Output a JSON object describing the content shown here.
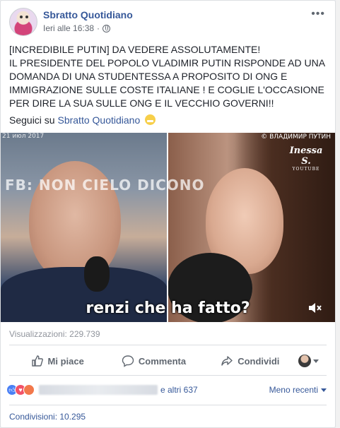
{
  "post": {
    "page_name": "Sbratto Quotidiano",
    "timestamp": "Ieri alle 16:38",
    "privacy_icon": "globe-icon",
    "more_icon": "ellipsis-icon",
    "text": "[INCREDIBILE PUTIN] DA VEDERE ASSOLUTAMENTE!\nIL PRESIDENTE DEL POPOLO VLADIMIR PUTIN RISPONDE AD UNA DOMANDA DI UNA STUDENTESSA A PROPOSITO DI ONG E IMMIGRAZIONE SULLE COSTE ITALIANE ! E COGLIE L'OCCASIONE PER DIRE LA SUA SULLE ONG E IL VECCHIO GOVERNI!!",
    "follow_prefix": "Seguici su",
    "follow_link": "Sbratto Quotidiano"
  },
  "video": {
    "date_stamp": "21 июл 2017",
    "channel": "© ВЛАДИМИР ПУТИН",
    "logo_line1": "Inessa S.",
    "logo_line2": "YOUTUBE",
    "watermark": "FB: NON CIELO DICONO",
    "subtitle": "renzi che ha fatto?",
    "mute_icon": "speaker-muted-icon"
  },
  "stats": {
    "views": "Visualizzazioni: 229.739",
    "others": "e altri 637",
    "order": "Meno recenti",
    "shares": "Condivisioni: 10.295"
  },
  "actions": {
    "like": "Mi piace",
    "comment": "Commenta",
    "share": "Condividi"
  }
}
